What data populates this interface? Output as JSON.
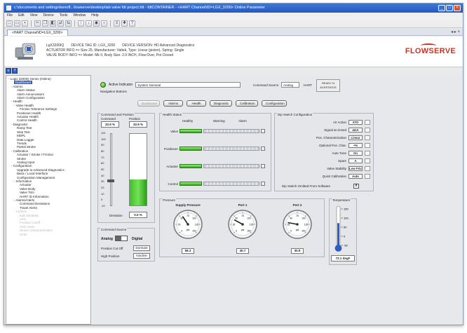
{
  "window": {
    "title": "c:\\documents and settings\\kenoff...\\lowserve\\desktop\\lab valve fdt project.fdt - fdtCONTAINER - <HART Channel\\ID=LGX_3200> Online Parameter"
  },
  "menu": [
    "File",
    "Edit",
    "View",
    "Device",
    "Tools",
    "Window",
    "Help"
  ],
  "doc_tab": "<HART Channel\\ID=LGX_3200>",
  "header": {
    "line1": [
      "LgX3200IQ",
      "DEVICE TAG ID: LGX_3200",
      "DEVICE VERSION: HD Advanced Diagnostics"
    ],
    "line2": "ACTUATOR INFO => Size 25, Manufacturer: Valtek, Type: Linear (piston), Spring: Single",
    "line3": "VALVE BODY INFO => Model: Mk II, Body Size: 2.0 INCH, Flow:Over, Pot Closed",
    "logo": "FLOWSERVE"
  },
  "tree": [
    {
      "t": "- Logix 3200IQ Series (Online)",
      "i": 0
    },
    {
      "t": "Dashboard",
      "i": 2,
      "sel": true
    },
    {
      "t": "- Alarms",
      "i": 1
    },
    {
      "t": "Alarm Status",
      "i": 3
    },
    {
      "t": "Alarm Annunciators",
      "i": 3
    },
    {
      "t": "Alarm Configuration",
      "i": 3
    },
    {
      "t": "- Health",
      "i": 1
    },
    {
      "t": "- Valve Health",
      "i": 2
    },
    {
      "t": "Friction Tolerance Settings",
      "i": 4
    },
    {
      "t": "Positioner Health",
      "i": 3
    },
    {
      "t": "Actuator Health",
      "i": 3
    },
    {
      "t": "Control Health",
      "i": 3
    },
    {
      "t": "- Diagnostic",
      "i": 1
    },
    {
      "t": "Ramp Test",
      "i": 3
    },
    {
      "t": "Step Test",
      "i": 3
    },
    {
      "t": "MDPL",
      "i": 3
    },
    {
      "t": "Data Logger",
      "i": 3
    },
    {
      "t": "Trends",
      "i": 3
    },
    {
      "t": "Partial Stroke",
      "i": 3
    },
    {
      "t": "- Calibration",
      "i": 1
    },
    {
      "t": "Actuator / Stroke / Friction",
      "i": 3
    },
    {
      "t": "Stroke",
      "i": 3
    },
    {
      "t": "Analog Input",
      "i": 3
    },
    {
      "t": "- Configuration",
      "i": 1
    },
    {
      "t": "Upgrade to Advanced Diagnostics",
      "i": 3
    },
    {
      "t": "Basic / Local Interface",
      "i": 3
    },
    {
      "t": "Configuration Management",
      "i": 3
    },
    {
      "t": "- Information",
      "i": 2
    },
    {
      "t": "Actuator",
      "i": 4
    },
    {
      "t": "Valve Body",
      "i": 4
    },
    {
      "t": "Valve Trim",
      "i": 4
    },
    {
      "t": "HART ID Information",
      "i": 4
    },
    {
      "t": "- Alarms/Alerts",
      "i": 2
    },
    {
      "t": "Command Deviations",
      "i": 4
    },
    {
      "t": "Travel Alerts",
      "i": 4
    },
    {
      "t": "- Custom",
      "i": 2,
      "gray": true
    },
    {
      "t": "Edit Variables",
      "i": 4,
      "gray": true
    },
    {
      "t": "LED",
      "i": 4,
      "gray": true
    },
    {
      "t": "Position Cutoff",
      "i": 4,
      "gray": true
    },
    {
      "t": "Soft Limits",
      "i": 4,
      "gray": true
    },
    {
      "t": "Stroke Characterization",
      "i": 4,
      "gray": true
    },
    {
      "t": "Units",
      "i": 4,
      "gray": true
    }
  ],
  "active": {
    "label": "Active Indicator",
    "value": "System Nominal",
    "cmd_label": "Command Source",
    "cmd_value": "Analog",
    "hart": "HART",
    "ready1": "READY N",
    "ready2": "ACKSTATUS"
  },
  "nav": {
    "label": "Navigation Buttons",
    "buttons": [
      "Dashboard",
      "Alarms",
      "Health",
      "Diagnostic",
      "Calibration",
      "Configuration"
    ]
  },
  "cmdpos": {
    "title": "Command and Position",
    "cmd_label": "Command",
    "pos_label": "Position",
    "cmd_value": "32.9 %",
    "pos_value": "32.9 %",
    "ticks": [
      "110",
      "100",
      "90",
      "80",
      "70",
      "60",
      "50",
      "40",
      "30",
      "20",
      "10",
      "0",
      "-10"
    ],
    "dev_label": "Deviation",
    "dev_value": "0.0 %",
    "position_fraction": 0.33
  },
  "health": {
    "title": "Health Status",
    "cols": [
      "Healthy",
      "Warning",
      "Alarm"
    ],
    "rows": [
      "Valve",
      "Positioner",
      "Actuator",
      "Control"
    ]
  },
  "dip": {
    "title": "Dip Switch Configuration",
    "rows": [
      {
        "label": "Air Action",
        "value": "ATO"
      },
      {
        "label": "Signal at closed",
        "value": "4mA"
      },
      {
        "label": "Pos. Characterization",
        "value": "Linear"
      },
      {
        "label": "Optional Pos. Char.",
        "value": "+%"
      },
      {
        "label": "Auto Tune",
        "value": "On"
      },
      {
        "label": "Spare",
        "value": "A"
      },
      {
        "label": "Valve Stability",
        "value": "Low Fric"
      },
      {
        "label": "Quick Calibration",
        "value": "Auto"
      }
    ],
    "footer": "Dip Switch Omitted From Software",
    "footer_mark": "X"
  },
  "cmdsrc": {
    "title": "Command Source",
    "analog": "Analog",
    "digital": "Digital",
    "cutoff_label": "Position Cut Off",
    "cutoff_value": "Dormant",
    "high_label": "High Position",
    "high_value": "Inactive"
  },
  "pressure": {
    "title": "Pressure",
    "gauges": [
      {
        "name": "Supply Pressure",
        "value": "56.3",
        "unit": "psi",
        "reading": 56.3
      },
      {
        "name": "Port 1",
        "value": "40.7",
        "unit": "psi",
        "reading": 40.7
      },
      {
        "name": "Port 2",
        "value": "30.9",
        "unit": "psi",
        "reading": 30.9
      }
    ],
    "scale": [
      "0",
      "25",
      "50",
      "75",
      "100",
      "125",
      "150"
    ]
  },
  "temperature": {
    "title": "Temperature",
    "ticks": [
      "150",
      "100",
      "50",
      "0",
      "-50"
    ],
    "value": "72.1 degF",
    "reading": 72.1
  },
  "colors": {
    "accent": "#2a5fd1",
    "healthy": "#2fa81c",
    "brand": "#d32f1f"
  }
}
